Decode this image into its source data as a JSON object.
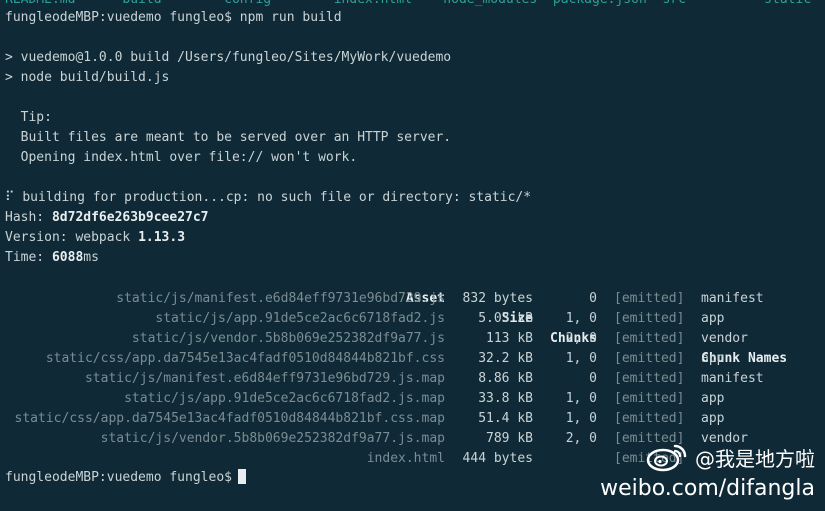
{
  "terminal": {
    "ls_output": "README.md      build        config        index.html    node_modules  package.json  src          static",
    "prompt_command": "fungleodeMBP:vuedemo fungleo$ npm run build",
    "npm_line1": "> vuedemo@1.0.0 build /Users/fungleo/Sites/MyWork/vuedemo",
    "npm_line2": "> node build/build.js",
    "tip_label": "  Tip:",
    "tip_line1": "  Built files are meant to be served over an HTTP server.",
    "tip_line2": "  Opening index.html over file:// won't work.",
    "building_line": "⠏ building for production...cp: no such file or directory: static/*",
    "hash_label": "Hash: ",
    "hash_value": "8d72df6e263b9cee27c7",
    "version_label": "Version: webpack ",
    "version_value": "1.13.3",
    "time_label": "Time: ",
    "time_value": "6088",
    "time_unit": "ms",
    "final_prompt": "fungleodeMBP:vuedemo fungleo$"
  },
  "table": {
    "headers": {
      "asset": "Asset",
      "size": "Size",
      "chunks": "Chunks",
      "status": "",
      "name": "Chunk Names"
    },
    "rows": [
      {
        "asset": "static/js/manifest.e6d84eff9731e96bd729.js",
        "size": "832 bytes",
        "chunks": "0",
        "status": "[emitted]",
        "name": "manifest"
      },
      {
        "asset": "static/js/app.91de5ce2ac6c6718fad2.js",
        "size": "5.03 kB",
        "chunks": "1, 0",
        "status": "[emitted]",
        "name": "app"
      },
      {
        "asset": "static/js/vendor.5b8b069e252382df9a77.js",
        "size": "113 kB",
        "chunks": "2, 0",
        "status": "[emitted]",
        "name": "vendor"
      },
      {
        "asset": "static/css/app.da7545e13ac4fadf0510d84844b821bf.css",
        "size": "32.2 kB",
        "chunks": "1, 0",
        "status": "[emitted]",
        "name": "app"
      },
      {
        "asset": "static/js/manifest.e6d84eff9731e96bd729.js.map",
        "size": "8.86 kB",
        "chunks": "0",
        "status": "[emitted]",
        "name": "manifest"
      },
      {
        "asset": "static/js/app.91de5ce2ac6c6718fad2.js.map",
        "size": "33.8 kB",
        "chunks": "1, 0",
        "status": "[emitted]",
        "name": "app"
      },
      {
        "asset": "static/css/app.da7545e13ac4fadf0510d84844b821bf.css.map",
        "size": "51.4 kB",
        "chunks": "1, 0",
        "status": "[emitted]",
        "name": "app"
      },
      {
        "asset": "static/js/vendor.5b8b069e252382df9a77.js.map",
        "size": "789 kB",
        "chunks": "2, 0",
        "status": "[emitted]",
        "name": "vendor"
      },
      {
        "asset": "index.html",
        "size": "444 bytes",
        "chunks": "",
        "status": "[emitted]",
        "name": ""
      }
    ]
  },
  "watermark": {
    "handle": "@我是地方啦",
    "url": "weibo.com/difangla",
    "icon": "weibo-icon"
  }
}
